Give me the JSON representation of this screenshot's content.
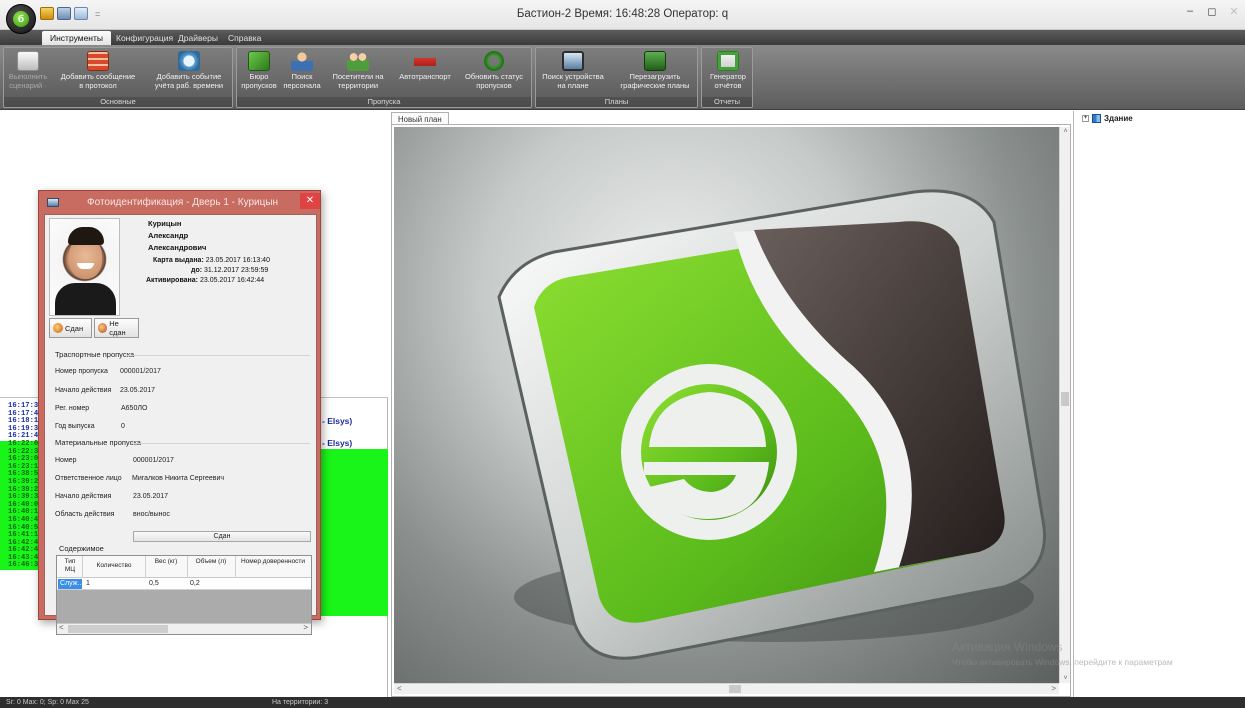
{
  "window": {
    "title": "Бастион-2 Время: 16:48:28 Оператор: q",
    "minimize": "–",
    "restore": "◻",
    "close": "✕",
    "qat_more": "="
  },
  "ribbon": {
    "tabs": [
      "Инструменты",
      "Конфигурация",
      "Драйверы",
      "Справка"
    ],
    "groups": [
      {
        "title": "Основные",
        "buttons": [
          {
            "label": "Выполнить\nсценарий ·",
            "icon": "script-icon"
          },
          {
            "label": "Добавить сообщение\nв протокол",
            "icon": "protocol-icon"
          },
          {
            "label": "Добавить событие\nучёта раб. времени",
            "icon": "clock-icon"
          }
        ]
      },
      {
        "title": "Пропуска",
        "buttons": [
          {
            "label": "Бюро\nпропусков",
            "icon": "pass-bureau-icon"
          },
          {
            "label": "Поиск\nперсонала",
            "icon": "person-search-icon"
          },
          {
            "label": "Посетители на\nтерритории",
            "icon": "visitors-icon"
          },
          {
            "label": "Автотранспорт",
            "icon": "car-icon"
          },
          {
            "label": "Обновить статус\nпропусков",
            "icon": "refresh-icon"
          }
        ]
      },
      {
        "title": "Планы",
        "buttons": [
          {
            "label": "Поиск устройства\nна плане",
            "icon": "monitor-icon"
          },
          {
            "label": "Перезагрузить\nграфические планы",
            "icon": "reload-icon"
          }
        ]
      },
      {
        "title": "Отчеты",
        "buttons": [
          {
            "label": "Генератор\nотчётов",
            "icon": "report-icon"
          }
        ]
      }
    ]
  },
  "event_log": {
    "times": [
      {
        "t": "16:17:39",
        "c": "blue"
      },
      {
        "t": "16:17:40",
        "c": "blue"
      },
      {
        "t": "16:18:13",
        "c": "blue"
      },
      {
        "t": "16:19:34",
        "c": "blue"
      },
      {
        "t": "16:21:40",
        "c": "blue"
      },
      {
        "t": "16:22:09",
        "c": "green"
      },
      {
        "t": "16:22:37",
        "c": "green"
      },
      {
        "t": "16:23:08",
        "c": "green"
      },
      {
        "t": "16:23:19",
        "c": "green"
      },
      {
        "t": "16:38:50",
        "c": "green"
      },
      {
        "t": "16:39:25",
        "c": "green"
      },
      {
        "t": "16:39:25",
        "c": "green"
      },
      {
        "t": "16:39:30",
        "c": "green"
      },
      {
        "t": "16:40:03",
        "c": "green"
      },
      {
        "t": "16:40:10",
        "c": "green"
      },
      {
        "t": "16:40:46",
        "c": "green"
      },
      {
        "t": "16:40:50",
        "c": "green"
      },
      {
        "t": "16:41:16",
        "c": "green"
      },
      {
        "t": "16:42:44",
        "c": "green"
      },
      {
        "t": "16:42:49",
        "c": "green"
      },
      {
        "t": "16:43:45",
        "c": "green"
      },
      {
        "t": "16:46:37",
        "c": "green"
      }
    ],
    "text_1": "- Elsys)",
    "text_2": "- Elsys)"
  },
  "document": {
    "tab": "Новый план",
    "scroll_up": "˄",
    "scroll_down": "˅",
    "scroll_left": "<",
    "scroll_right": ">"
  },
  "tree": {
    "expander": "+",
    "root": "Здание"
  },
  "watermark": {
    "line1": "Активация Windows",
    "line2": "Чтобы активировать Windows, перейдите к параметрам"
  },
  "statusbar": {
    "left": "Sr: 0 Max: 0; Sp: 0 Max 25",
    "middle": "На территории: 3"
  },
  "dialog": {
    "title": "Фотоидентификация - Дверь 1 - Курицын",
    "close": "✕",
    "surname": "Курицын",
    "name": "Александр",
    "patronymic": "Александрович",
    "card": {
      "issued_label": "Карта выдана:",
      "issued_value": "23.05.2017 16:13:40",
      "until_label": "до:",
      "until_value": "31.12.2017 23:59:59",
      "activated_label": "Активирована:",
      "activated_value": "23.05.2017 16:42:44"
    },
    "btn_returned": "Сдан",
    "btn_not_returned": "Не сдан",
    "transport": {
      "section": "Траспортные пропуска",
      "number_label": "Номер пропуска",
      "number_value": "000001/2017",
      "start_label": "Начало действия",
      "start_value": "23.05.2017",
      "reg_label": "Рег. номер",
      "reg_value": "А650ЛО",
      "year_label": "Год выпуска",
      "year_value": "0"
    },
    "material": {
      "section": "Материальные пропуска",
      "number_label": "Номер",
      "number_value": "000001/2017",
      "resp_label": "Ответственное лицо",
      "resp_value": "Мигалков Никита Сергеевич",
      "start_label": "Начало действия",
      "start_value": "23.05.2017",
      "area_label": "Область действия",
      "area_value": "внос/вынос",
      "status": "Сдан"
    },
    "contents": {
      "section": "Содержимое",
      "headers": [
        "Тип\nМЦ",
        "Количество",
        "Вес\n(кг)",
        "Объем\n(л)",
        "Номер\nдоверенности"
      ],
      "row": [
        "Служ...",
        "1",
        "0,5",
        "0,2",
        ""
      ],
      "scroll_left": "<",
      "scroll_right": ">"
    }
  }
}
